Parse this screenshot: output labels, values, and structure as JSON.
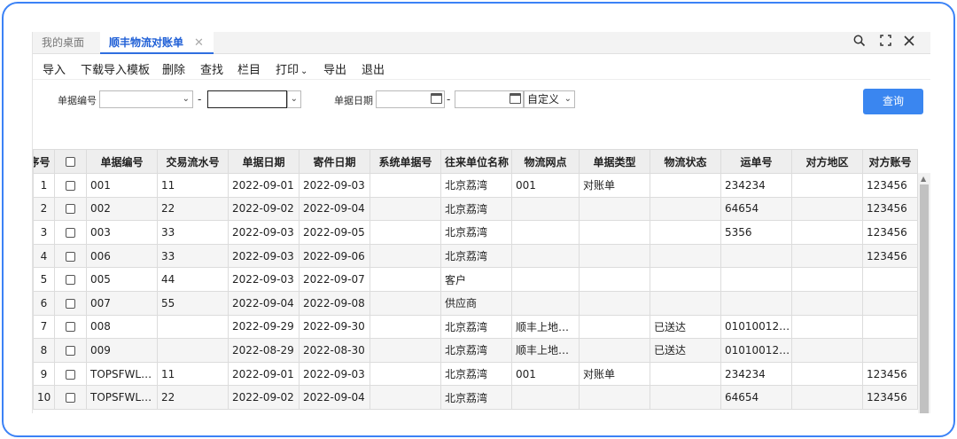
{
  "tabs": {
    "home": "我的桌面",
    "active": "顺丰物流对账单",
    "close": "✕"
  },
  "window_controls": {
    "search": "🔍",
    "maximize": "⛶",
    "close": "✕"
  },
  "toolbar": [
    "导入",
    "下载导入模板",
    "删除",
    "查找",
    "栏目",
    "打印",
    "导出",
    "退出"
  ],
  "filters": {
    "doc_no_label": "单据编号",
    "doc_date_label": "单据日期",
    "dash": "-",
    "period": "自定义",
    "query": "查询"
  },
  "table": {
    "headers": [
      "序号",
      "",
      "单据编号",
      "交易流水号",
      "单据日期",
      "寄件日期",
      "系统单据号",
      "往来单位名称",
      "物流网点",
      "单据类型",
      "物流状态",
      "运单号",
      "对方地区",
      "对方账号"
    ],
    "rows": [
      [
        "1",
        "001",
        "11",
        "2022-09-01",
        "2022-09-03",
        "",
        "北京荔湾",
        "001",
        "对账单",
        "",
        "234234",
        "",
        "123456"
      ],
      [
        "2",
        "002",
        "22",
        "2022-09-02",
        "2022-09-04",
        "",
        "北京荔湾",
        "",
        "",
        "",
        "64654",
        "",
        "123456"
      ],
      [
        "3",
        "003",
        "33",
        "2022-09-03",
        "2022-09-05",
        "",
        "北京荔湾",
        "",
        "",
        "",
        "5356",
        "",
        "123456"
      ],
      [
        "4",
        "006",
        "33",
        "2022-09-03",
        "2022-09-06",
        "",
        "北京荔湾",
        "",
        "",
        "",
        "",
        "",
        "123456"
      ],
      [
        "5",
        "005",
        "44",
        "2022-09-03",
        "2022-09-07",
        "",
        "客户",
        "",
        "",
        "",
        "",
        "",
        ""
      ],
      [
        "6",
        "007",
        "55",
        "2022-09-04",
        "2022-09-08",
        "",
        "供应商",
        "",
        "",
        "",
        "",
        "",
        ""
      ],
      [
        "7",
        "008",
        "",
        "2022-09-29",
        "2022-09-30",
        "",
        "北京荔湾",
        "顺丰上地…",
        "",
        "已送达",
        "01010012…",
        "",
        ""
      ],
      [
        "8",
        "009",
        "",
        "2022-08-29",
        "2022-08-30",
        "",
        "北京荔湾",
        "顺丰上地…",
        "",
        "已送达",
        "01010012…",
        "",
        ""
      ],
      [
        "9",
        "TOPSFWL…",
        "11",
        "2022-09-01",
        "2022-09-03",
        "",
        "北京荔湾",
        "001",
        "对账单",
        "",
        "234234",
        "",
        "123456"
      ],
      [
        "10",
        "TOPSFWL…",
        "22",
        "2022-09-02",
        "2022-09-04",
        "",
        "北京荔湾",
        "",
        "",
        "",
        "64654",
        "",
        "123456"
      ]
    ]
  }
}
